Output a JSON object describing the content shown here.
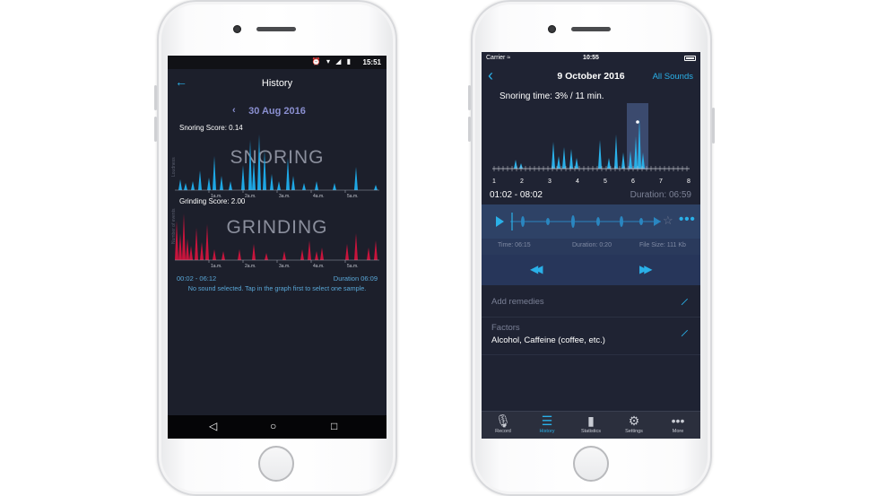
{
  "android": {
    "status": {
      "time": "15:51",
      "icons": [
        "alarm-icon",
        "wifi-icon",
        "signal-icon",
        "battery-icon"
      ]
    },
    "header": {
      "back_icon": "arrow-left-icon",
      "title": "History"
    },
    "date": "30 Aug 2016",
    "snoring": {
      "score_label": "Snoring Score: 0.14",
      "watermark": "SNORING",
      "y_label": "Loudness",
      "x_ticks": [
        "1a.m.",
        "2a.m.",
        "3a.m.",
        "4a.m.",
        "5a.m."
      ],
      "color": "#1ea7e4"
    },
    "grinding": {
      "score_label": "Grinding Score: 2.00",
      "watermark": "GRINDING",
      "y_label": "Number of events",
      "x_ticks": [
        "1a.m.",
        "2a.m.",
        "3a.m.",
        "4a.m.",
        "5a.m."
      ],
      "color": "#c8143c"
    },
    "range": "00:02 - 06:12",
    "duration": "Duration   06:09",
    "message": "No sound selected. Tap in the graph first to select one sample.",
    "nav": {
      "back": "◁",
      "home": "○",
      "recents": "□"
    }
  },
  "ios": {
    "status": {
      "carrier": "Carrier ≈",
      "time": "10:55"
    },
    "header": {
      "back_icon": "chevron-left-icon",
      "title": "9 October 2016",
      "right_link": "All Sounds"
    },
    "snoring_time": "Snoring time:   3% / 11 min.",
    "x_ticks": [
      "1",
      "2",
      "3",
      "4",
      "5",
      "6",
      "7",
      "8"
    ],
    "range": "01:02 - 08:02",
    "duration": "Duration: 06:59",
    "player": {
      "time": "Time: 06:15",
      "duration": "Duration: 0:20",
      "file_size": "File Size: 111 Kb",
      "rewind": "◀◀",
      "forward": "▶▶"
    },
    "add_remedies": "Add remedies",
    "factors_label": "Factors",
    "factors_value": "Alcohol, Caffeine (coffee, etc.)",
    "tabs": [
      {
        "label": "Record",
        "icon": "microphone-icon",
        "active": false
      },
      {
        "label": "History",
        "icon": "list-icon",
        "active": true
      },
      {
        "label": "Statistics",
        "icon": "bar-chart-icon",
        "active": false
      },
      {
        "label": "Settings",
        "icon": "gear-icon",
        "active": false
      },
      {
        "label": "More",
        "icon": "more-icon",
        "active": false
      }
    ],
    "accent": "#2ab0e8"
  }
}
